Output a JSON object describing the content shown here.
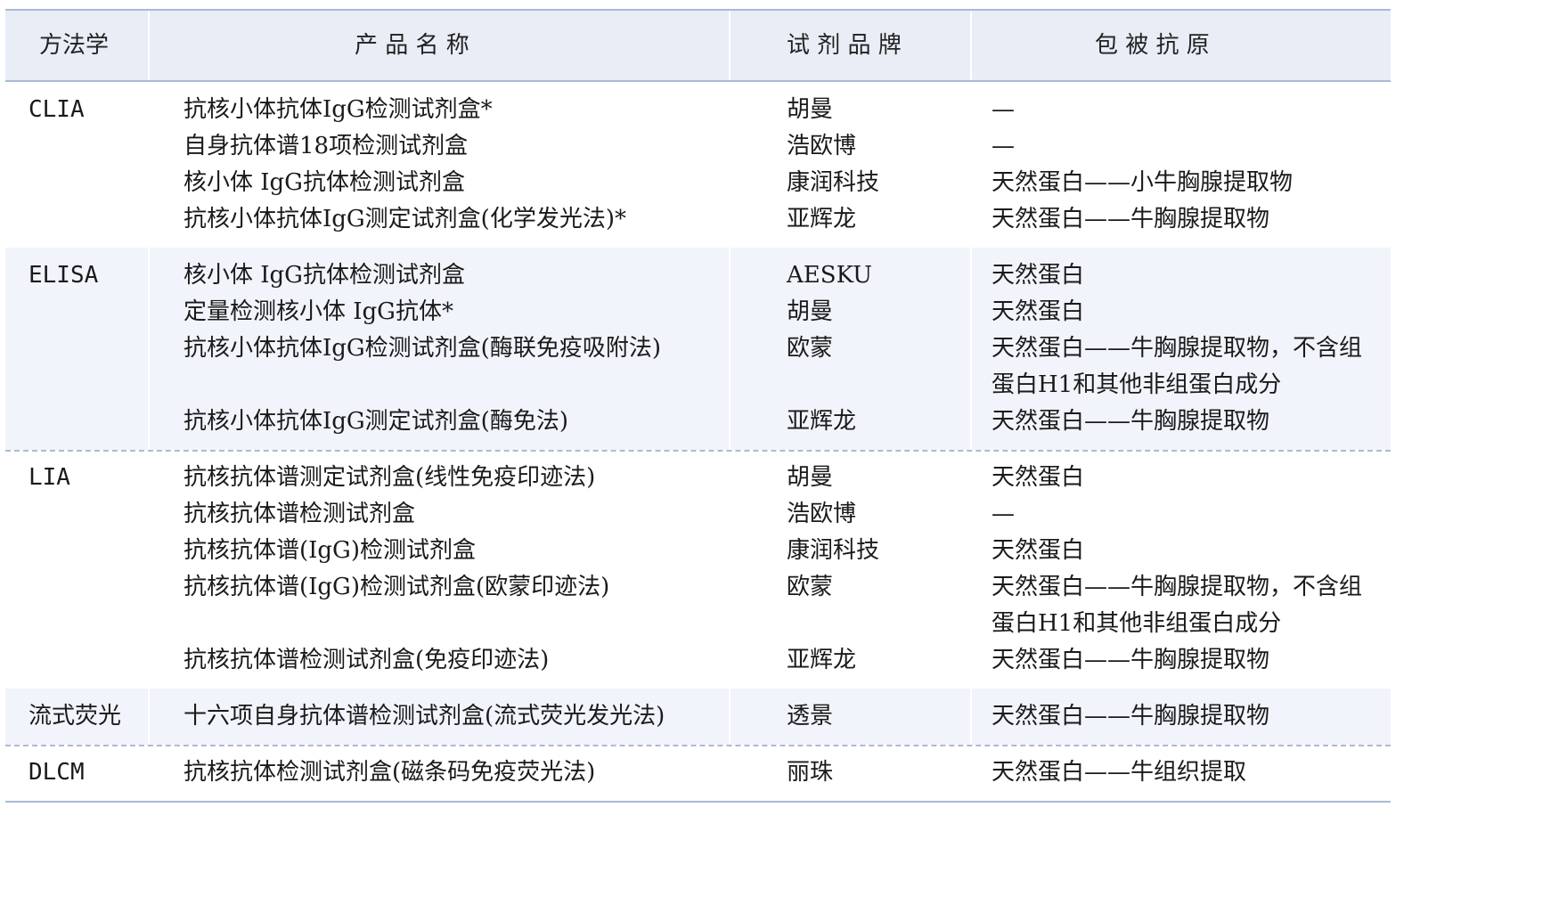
{
  "header": {
    "method": "方法学",
    "product": "产 品 名 称",
    "brand": "试 剂 品 牌",
    "antigen": "包 被 抗 原"
  },
  "groups": [
    {
      "method": "CLIA",
      "rows": [
        {
          "product": "抗核小体抗体IgG检测试剂盒*",
          "brand": "胡曼",
          "antigen": "—"
        },
        {
          "product": "自身抗体谱18项检测试剂盒",
          "brand": "浩欧博",
          "antigen": "—"
        },
        {
          "product": "核小体 IgG抗体检测试剂盒",
          "brand": "康润科技",
          "antigen": "天然蛋白——小牛胸腺提取物"
        },
        {
          "product": "抗核小体抗体IgG测定试剂盒(化学发光法)*",
          "brand": "亚辉龙",
          "antigen": "天然蛋白——牛胸腺提取物"
        }
      ]
    },
    {
      "method": "ELISA",
      "rows": [
        {
          "product": "核小体 IgG抗体检测试剂盒",
          "brand": "AESKU",
          "antigen": "天然蛋白"
        },
        {
          "product": "定量检测核小体 IgG抗体*",
          "brand": "胡曼",
          "antigen": "天然蛋白"
        },
        {
          "product": "抗核小体抗体IgG检测试剂盒(酶联免疫吸附法)",
          "brand": "欧蒙",
          "antigen": "天然蛋白——牛胸腺提取物，不含组蛋白H1和其他非组蛋白成分"
        },
        {
          "product": "抗核小体抗体IgG测定试剂盒(酶免法)",
          "brand": "亚辉龙",
          "antigen": "天然蛋白——牛胸腺提取物"
        }
      ]
    },
    {
      "method": "LIA",
      "rows": [
        {
          "product": "抗核抗体谱测定试剂盒(线性免疫印迹法)",
          "brand": "胡曼",
          "antigen": "天然蛋白"
        },
        {
          "product": "抗核抗体谱检测试剂盒",
          "brand": "浩欧博",
          "antigen": "—"
        },
        {
          "product": "抗核抗体谱(IgG)检测试剂盒",
          "brand": "康润科技",
          "antigen": "天然蛋白"
        },
        {
          "product": "抗核抗体谱(IgG)检测试剂盒(欧蒙印迹法)",
          "brand": "欧蒙",
          "antigen": "天然蛋白——牛胸腺提取物，不含组蛋白H1和其他非组蛋白成分"
        },
        {
          "product": "抗核抗体谱检测试剂盒(免疫印迹法)",
          "brand": "亚辉龙",
          "antigen": "天然蛋白——牛胸腺提取物"
        }
      ]
    },
    {
      "method": "流式荧光",
      "rows": [
        {
          "product": "十六项自身抗体谱检测试剂盒(流式荧光发光法)",
          "brand": "透景",
          "antigen": "天然蛋白——牛胸腺提取物"
        }
      ]
    },
    {
      "method": "DLCM",
      "rows": [
        {
          "product": "抗核抗体检测试剂盒(磁条码免疫荧光法)",
          "brand": "丽珠",
          "antigen": "天然蛋白——牛组织提取"
        }
      ]
    }
  ]
}
